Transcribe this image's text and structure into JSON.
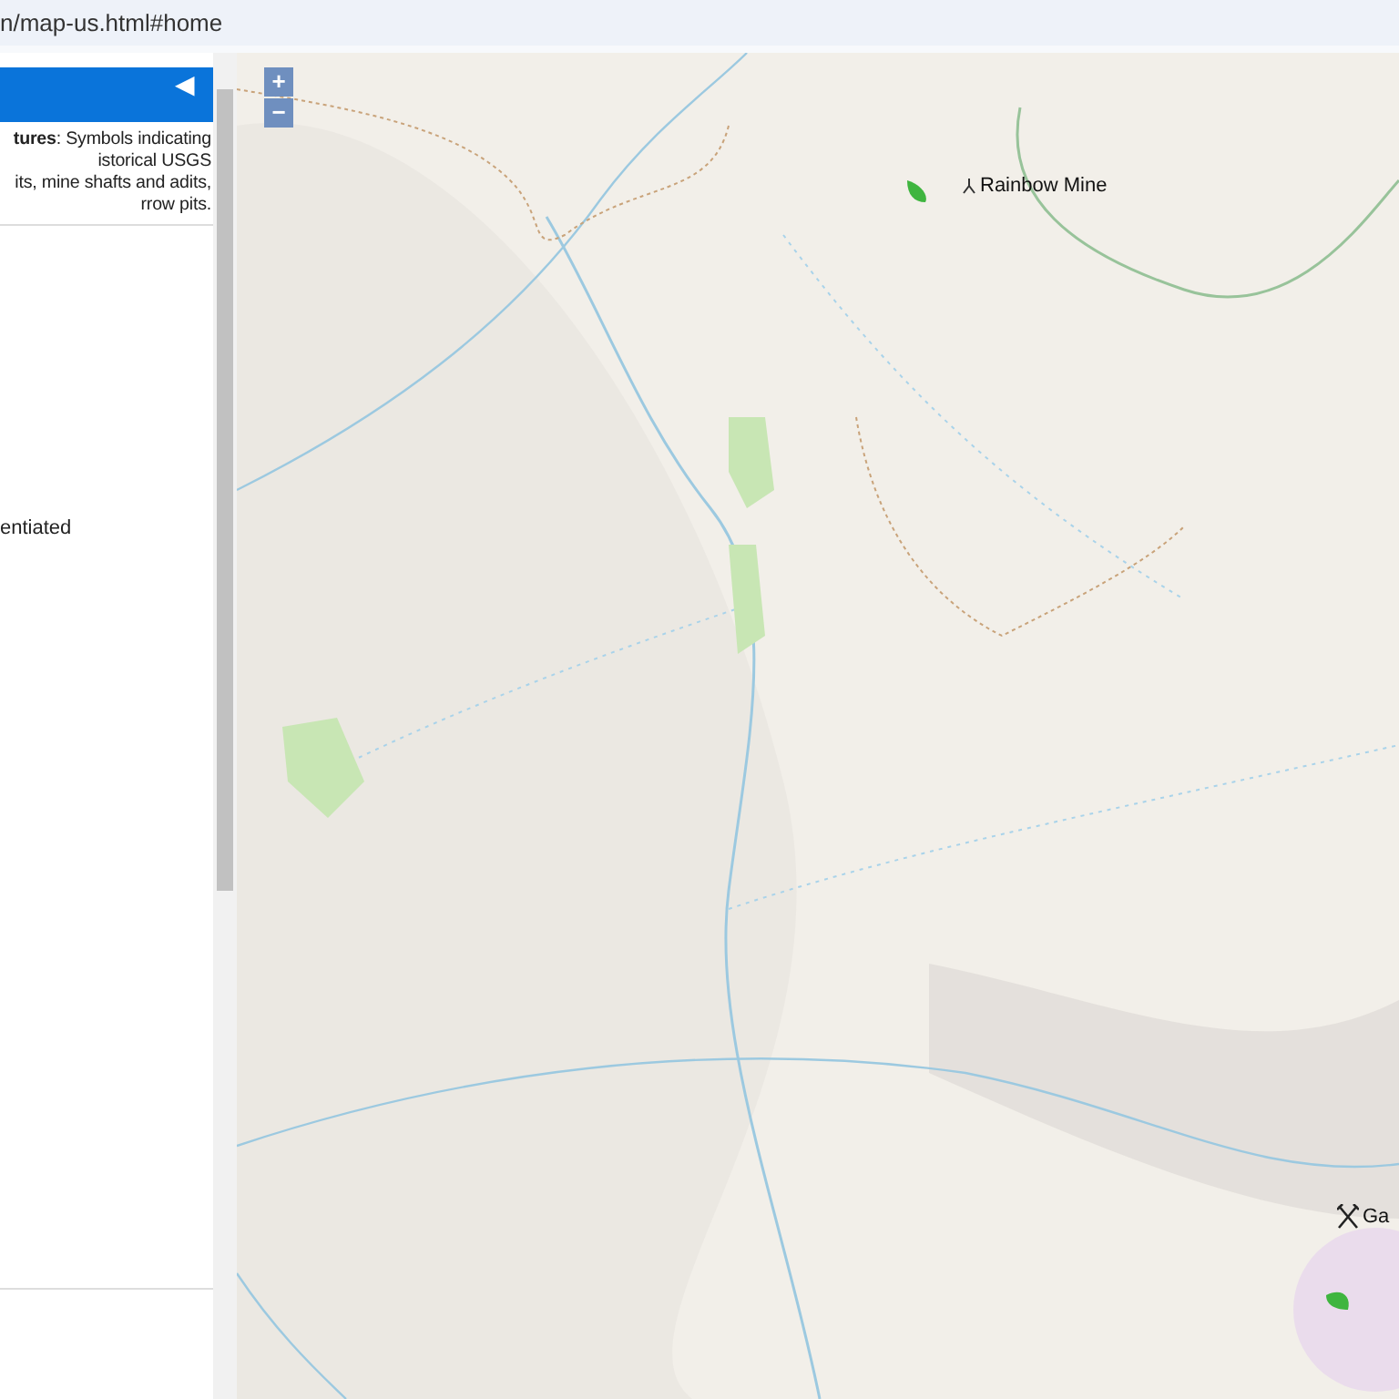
{
  "address_bar": {
    "url": "n/map-us.html#home"
  },
  "sidebar": {
    "header": {
      "collapse_glyph": "◀"
    },
    "legend_lines": [
      "**tures**: Symbols indicating",
      "istorical USGS",
      "its, mine shafts and adits,",
      "rrow pits."
    ],
    "note": "entiated"
  },
  "map": {
    "zoom_in": "+",
    "zoom_out": "−",
    "markers": [
      {
        "kind": "adit",
        "label": "Rainbow Mine"
      },
      {
        "kind": "mine",
        "label": "Ga"
      }
    ]
  }
}
